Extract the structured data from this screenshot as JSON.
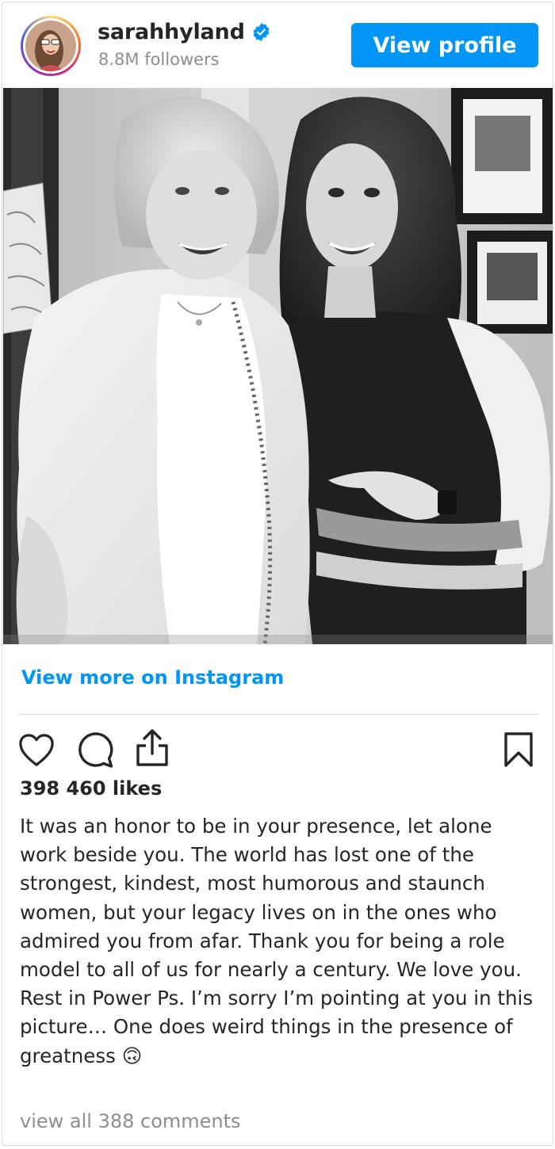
{
  "header": {
    "username": "sarahhyland",
    "followers": "8.8M followers",
    "view_profile_label": "View profile"
  },
  "post": {
    "view_more_label": "View more on Instagram",
    "likes": "398 460 likes",
    "caption": "It was an honor to be in your presence, let alone work beside you. The world has lost one of the strongest, kindest, most humorous and staunch women, but your legacy lives on in the ones who admired you from afar. Thank you for being a role model to all of us for nearly a century. We love you. Rest in Power Ps. I’m sorry I’m pointing at you in this picture… One does weird things in the presence of greatness 🙃",
    "comments_link": "view all 388 comments"
  },
  "icons": {
    "verified": "verified-badge-icon",
    "like": "heart-icon",
    "comment": "comment-icon",
    "share": "share-icon",
    "save": "bookmark-icon"
  },
  "colors": {
    "accent": "#0095f6",
    "text": "#262626",
    "muted": "#8e8e8e",
    "border": "#dbdbdb"
  }
}
